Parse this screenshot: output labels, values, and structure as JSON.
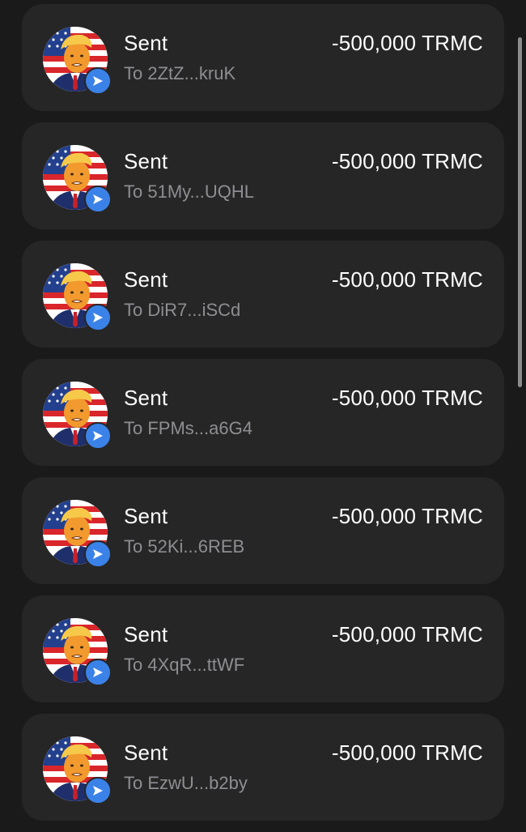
{
  "transactions": [
    {
      "type": "Sent",
      "to": "To 2ZtZ...kruK",
      "amount": "-500,000 TRMC"
    },
    {
      "type": "Sent",
      "to": "To 51My...UQHL",
      "amount": "-500,000 TRMC"
    },
    {
      "type": "Sent",
      "to": "To DiR7...iSCd",
      "amount": "-500,000 TRMC"
    },
    {
      "type": "Sent",
      "to": "To FPMs...a6G4",
      "amount": "-500,000 TRMC"
    },
    {
      "type": "Sent",
      "to": "To 52Ki...6REB",
      "amount": "-500,000 TRMC"
    },
    {
      "type": "Sent",
      "to": "To 4XqR...ttWF",
      "amount": "-500,000 TRMC"
    },
    {
      "type": "Sent",
      "to": "To EzwU...b2by",
      "amount": "-500,000 TRMC"
    }
  ],
  "icons": {
    "avatar": "token-avatar-icon",
    "badge": "send-arrow-icon"
  },
  "colors": {
    "background": "#1a1a1a",
    "card": "#262626",
    "badge": "#3b82e8",
    "secondary_text": "#8e8e93"
  }
}
